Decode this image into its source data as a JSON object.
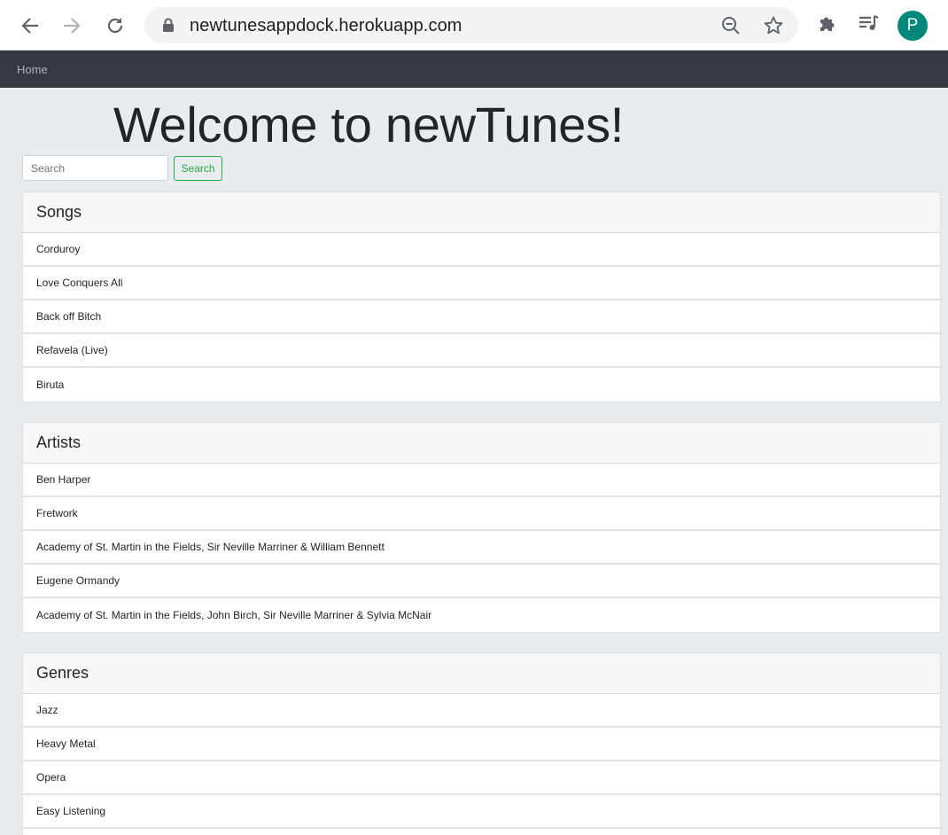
{
  "browser": {
    "url": "newtunesappdock.herokuapp.com",
    "profile_initial": "P",
    "profile_color": "#00897b"
  },
  "navbar": {
    "home_label": "Home"
  },
  "page": {
    "title": "Welcome to newTunes!"
  },
  "search": {
    "placeholder": "Search",
    "button_label": "Search"
  },
  "songs": {
    "header": "Songs",
    "items": [
      "Corduroy",
      "Love Conquers All",
      "Back off Bitch",
      "Refavela (Live)",
      "Biruta"
    ]
  },
  "artists": {
    "header": "Artists",
    "items": [
      "Ben Harper",
      "Fretwork",
      "Academy of St. Martin in the Fields, Sir Neville Marriner & William Bennett",
      "Eugene Ormandy",
      "Academy of St. Martin in the Fields, John Birch, Sir Neville Marriner & Sylvia McNair"
    ]
  },
  "genres": {
    "header": "Genres",
    "items": [
      "Jazz",
      "Heavy Metal",
      "Opera",
      "Easy Listening"
    ]
  }
}
